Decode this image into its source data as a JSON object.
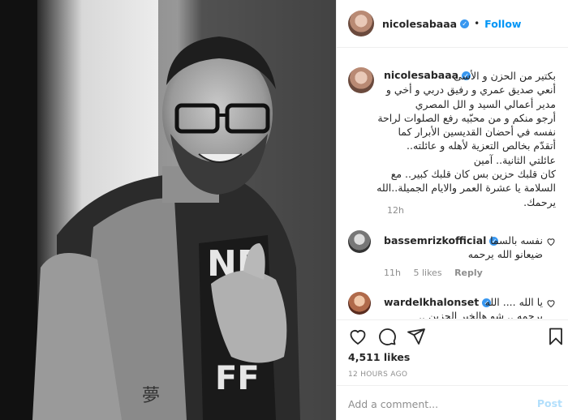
{
  "post": {
    "username": "nicolesabaaa",
    "follow_label": "Follow",
    "caption_lines": "بكتير من الحزن و الأسى\nأنعي صديق عمري و رفيق دربي و أخي و\nمدير أعمالي السيد و الل المصري\nأرجو منكم و من محبّيه رفع الصلوات لراحة\nنفسه في أحضان القديسين الأبرار كما\nأتقدّم بخالص التعزية لأهله و عائلته..\nعائلتي الثانية.. آمين\nكان قلبك حزين بس كان قلبك كبير.. مع\nالسلامة يا عشرة العمر والايام الجميلة..الله\nيرحمك.",
    "caption_time": "12h",
    "likes": "4,511 likes",
    "posted_ago": "12 HOURS AGO"
  },
  "comments": [
    {
      "username": "bassemrizkofficial",
      "text": "نفسه بالسما\nضيعانو الله يرحمه",
      "time": "11h",
      "likes": "5 likes",
      "reply": "Reply"
    },
    {
      "username": "wardelkhalonset",
      "text": "يا الله .... الله\nيرحمه .. شو هالخبر الحزين ..",
      "time": "",
      "likes": "",
      "reply": ""
    }
  ],
  "composer": {
    "placeholder": "Add a comment...",
    "post_label": "Post"
  },
  "colors": {
    "accent": "#0095f6",
    "verified": "#3897f0",
    "muted": "#8e8e8e",
    "post_disabled": "#b2dffc"
  },
  "icons": [
    "verified-badge-icon",
    "heart-icon",
    "comment-icon",
    "share-icon",
    "bookmark-icon"
  ]
}
